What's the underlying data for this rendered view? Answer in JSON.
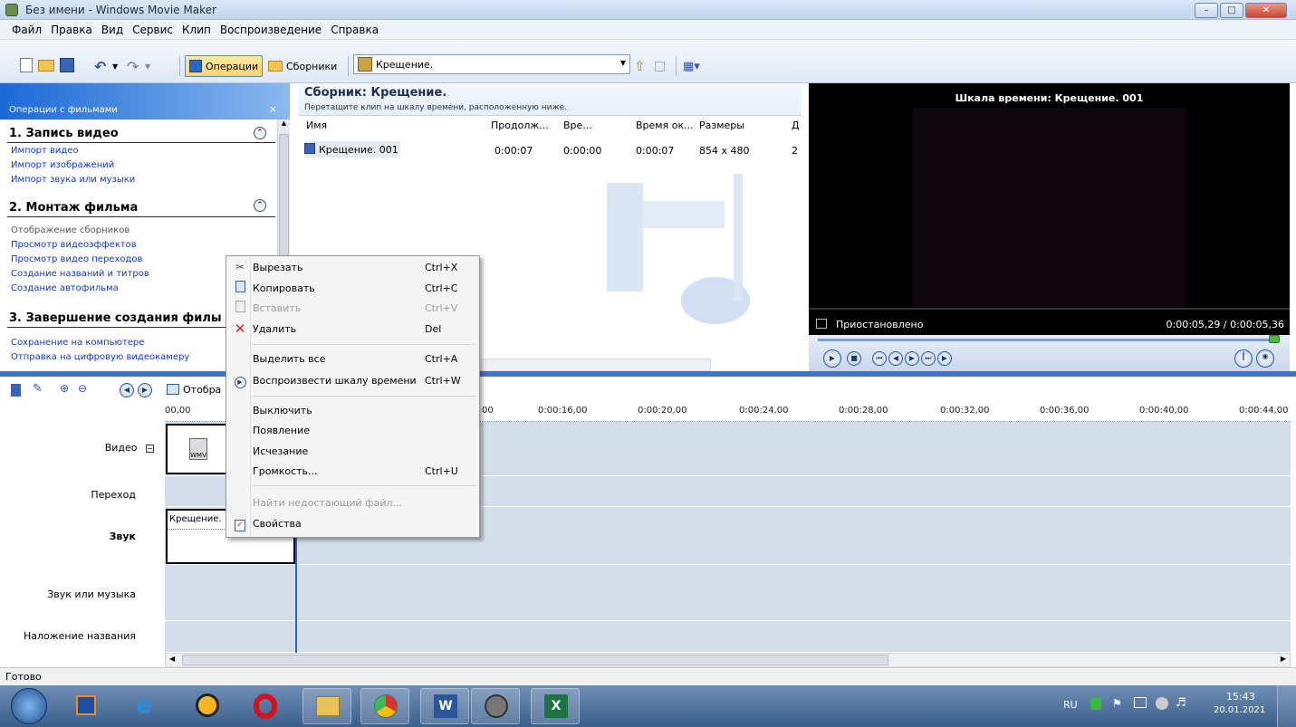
{
  "window": {
    "title": "Без имени - Windows Movie Maker"
  },
  "menu": [
    "Файл",
    "Правка",
    "Вид",
    "Сервис",
    "Клип",
    "Воспроизведение",
    "Справка"
  ],
  "toolbar": {
    "operations": "Операции",
    "collections": "Сборники",
    "collection_select": "Крещение."
  },
  "tasks": {
    "header": "Операции с фильмами",
    "sections": [
      {
        "title": "1. Запись видео",
        "links": [
          "Импорт видео",
          "Импорт изображений",
          "Импорт звука или музыки"
        ]
      },
      {
        "title": "2. Монтаж фильма",
        "links": [
          "Отображение сборников",
          "Просмотр видеоэффектов",
          "Просмотр видео переходов",
          "Создание названий и титров",
          "Создание автофильма"
        ]
      },
      {
        "title": "3. Завершение создания филы",
        "links": [
          "Сохранение на компьютере",
          "Отправка на цифровую видеокамеру"
        ]
      }
    ]
  },
  "collection": {
    "title": "Сборник: Крещение.",
    "subtitle": "Перетащите клип на шкалу времени, расположенную ниже.",
    "columns": [
      "Имя",
      "Продолж...",
      "Вре...",
      "Время ок...",
      "Размеры",
      "Д"
    ],
    "rows": [
      {
        "name": "Крещение. 001",
        "duration": "0:00:07",
        "start": "0:00:00",
        "end": "0:00:07",
        "size": "854 x 480",
        "extra": "2"
      }
    ]
  },
  "preview": {
    "title": "Шкала времени: Крещение. 001",
    "status": "Приостановлено",
    "time": "0:00:05,29 / 0:00:05,36"
  },
  "timeline": {
    "toolbar_label": "Отобра",
    "ticks": [
      "00,00",
      "00",
      "0:00:16,00",
      "0:00:20,00",
      "0:00:24,00",
      "0:00:28,00",
      "0:00:32,00",
      "0:00:36,00",
      "0:00:40,00",
      "0:00:44,00"
    ],
    "tracks": [
      "Видео",
      "Переход",
      "Звук",
      "Звук или музыка",
      "Наложение названия"
    ],
    "clip_audio_label": "Крещение.",
    "clip_video_icon_text": "WMV"
  },
  "context_menu": {
    "items": [
      {
        "label": "Вырезать",
        "shortcut": "Ctrl+X",
        "icon": "scissors-icon",
        "disabled": false
      },
      {
        "label": "Копировать",
        "shortcut": "Ctrl+C",
        "icon": "copy-icon",
        "disabled": false
      },
      {
        "label": "Вставить",
        "shortcut": "Ctrl+V",
        "icon": "paste-icon",
        "disabled": true
      },
      {
        "label": "Удалить",
        "shortcut": "Del",
        "icon": "delete-icon",
        "disabled": false
      },
      {
        "label": "Выделить все",
        "shortcut": "Ctrl+A",
        "disabled": false
      },
      {
        "label": "Воспроизвести шкалу времени",
        "shortcut": "Ctrl+W",
        "icon": "play-icon",
        "disabled": false
      },
      {
        "label": "Выключить",
        "shortcut": "",
        "disabled": false
      },
      {
        "label": "Появление",
        "shortcut": "",
        "disabled": false
      },
      {
        "label": "Исчезание",
        "shortcut": "",
        "disabled": false
      },
      {
        "label": "Громкость...",
        "shortcut": "Ctrl+U",
        "disabled": false
      },
      {
        "label": "Найти недостающий файл...",
        "shortcut": "",
        "disabled": true
      },
      {
        "label": "Свойства",
        "shortcut": "",
        "icon": "properties-icon",
        "disabled": false
      }
    ]
  },
  "statusbar": {
    "text": "Готово"
  },
  "taskbar": {
    "lang": "RU",
    "time": "15:43",
    "date": "20.01.2021"
  },
  "colors": {
    "accent": "#1b69d6",
    "timeline_track": "#d3deea",
    "delete_red": "#d42020"
  }
}
